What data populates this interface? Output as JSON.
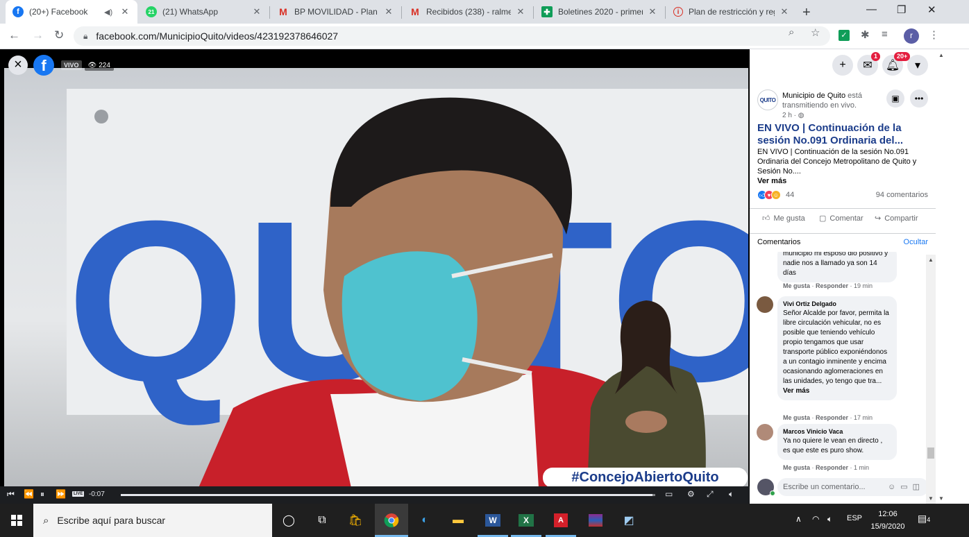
{
  "browser": {
    "tabs": [
      {
        "title": "(20+) Facebook",
        "icon": "facebook-icon",
        "active": true,
        "audio": true
      },
      {
        "title": "(21) WhatsApp",
        "icon": "whatsapp-icon",
        "active": false
      },
      {
        "title": "BP MOVILIDAD - Plan H",
        "icon": "gmail-icon",
        "active": false
      },
      {
        "title": "Recibidos (238) - ralme",
        "icon": "gmail-icon",
        "active": false
      },
      {
        "title": "Boletines 2020 - primer",
        "icon": "sheets-icon",
        "active": false
      },
      {
        "title": "Plan de restricción y reg",
        "icon": "info-icon",
        "active": false
      }
    ],
    "url": "facebook.com/MunicipioQuito/videos/423192378646027",
    "profile_initial": "r",
    "whatsapp_badge": "21"
  },
  "video": {
    "live_label": "VIVO",
    "viewer_count": "224",
    "hashtag": "#ConcejoAbiertoQuito",
    "sign_text": "QUITO",
    "live_mini": "LIVE",
    "time_remaining": "-0:07",
    "progress_fraction": 0.995
  },
  "panel": {
    "messenger_badge": "1",
    "notifications_badge": "20+",
    "page_avatar_text": "QUITO",
    "page_name": "Municipio de Quito",
    "page_action": "está transmitiendo en vivo.",
    "time_ago": "2 h ·",
    "post_title": "EN VIVO | Continuación de la sesión No.091 Ordinaria del...",
    "post_body": "EN VIVO | Continuación de la sesión No.091 Ordinaria del Concejo Metropolitano de Quito y Sesión No....",
    "see_more": "Ver más",
    "reaction_count": "44",
    "comment_count": "94 comentarios",
    "actions": {
      "like": "Me gusta",
      "comment": "Comentar",
      "share": "Compartir"
    },
    "comments_label": "Comentarios",
    "hide_label": "Ocultar",
    "comments": [
      {
        "name": "",
        "text": "municipio mi esposo dio positivo y nadie nos a llamado ya son 14 días",
        "like": "Me gusta",
        "reply": "Responder",
        "time": "19 min"
      },
      {
        "name": "Vivi Ortiz Delgado",
        "text": "Señor Alcalde por favor, permita la libre circulación vehicular, no es posible que teniendo vehículo propio tengamos que usar transporte público exponiéndonos a un contagio inminente y encima ocasionando aglomeraciones en las unidades, yo tengo que tra...",
        "see_more": "Ver más",
        "like": "Me gusta",
        "reply": "Responder",
        "time": "17 min"
      },
      {
        "name": "Marcos Vinicio Vaca",
        "text": "Ya no quiere le vean en directo , es que este es puro show.",
        "like": "Me gusta",
        "reply": "Responder",
        "time": "1 min"
      }
    ],
    "write_placeholder": "Escribe un comentario..."
  },
  "taskbar": {
    "search_placeholder": "Escribe aquí para buscar",
    "language": "ESP",
    "time": "12:06",
    "date": "15/9/2020",
    "notification_count": "4"
  }
}
